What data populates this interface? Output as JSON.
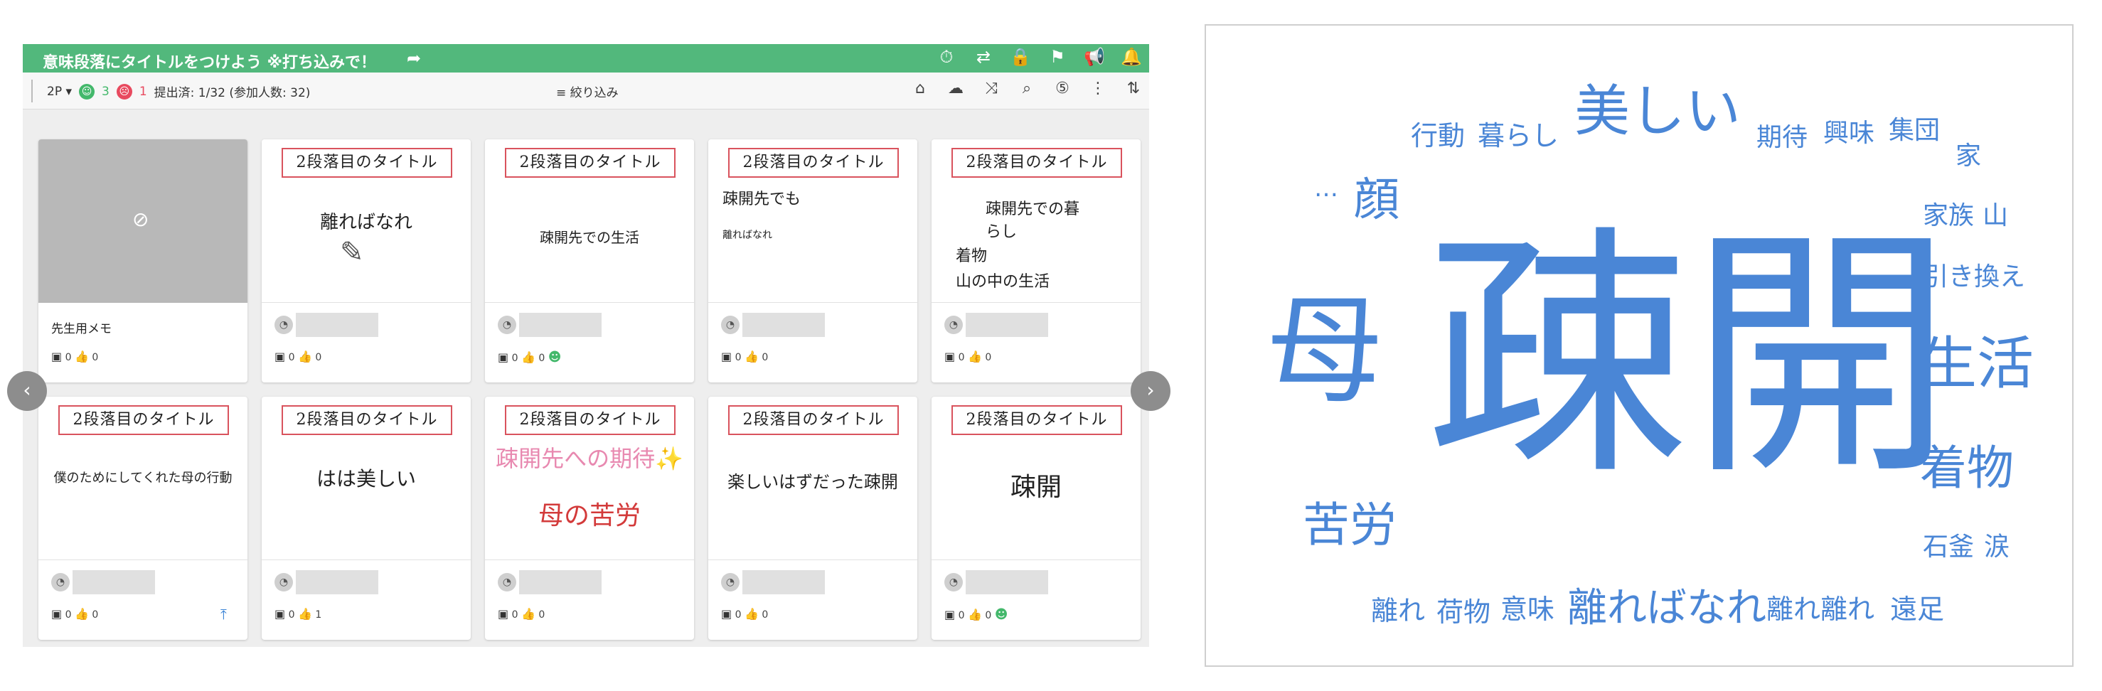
{
  "app": {
    "title": "意味段落にタイトルをつけよう ※打ち込みで！",
    "share_icon": "share-arrow-icon",
    "header_icons": [
      "timer-icon",
      "translate-icon",
      "lock-icon",
      "person-flag-icon",
      "megaphone-icon",
      "bell-icon"
    ],
    "toolbar": {
      "view_mode": "2P",
      "good_count": "3",
      "bad_count": "1",
      "submission": "提出済: 1/32 (参加人数: 32)",
      "filter_label": "絞り込み",
      "tool_icons": [
        "tag-icon",
        "cloud-abc-icon",
        "shuffle-icon",
        "qr-search-icon",
        "number-5-icon",
        "more-vertical-icon",
        "sort-icon"
      ]
    },
    "header_title": "2段落目のタイトル",
    "teacher_memo": "先生用メモ",
    "cards": [
      {
        "body": "",
        "comments": "0",
        "likes": "0",
        "teacher": true
      },
      {
        "body": "離ればなれ",
        "comments": "0",
        "likes": "0"
      },
      {
        "body": "疎開先での生活",
        "comments": "0",
        "likes": "0",
        "smile": true
      },
      {
        "body_lines": [
          "疎開先でも",
          "離ればなれ"
        ],
        "comments": "0",
        "likes": "0"
      },
      {
        "body_lines": [
          "疎開先での暮",
          "らし",
          "着物",
          "山の中の生活"
        ],
        "comments": "0",
        "likes": "0"
      },
      {
        "body": "僕のためにしてくれた母の行動",
        "comments": "0",
        "likes": "0",
        "pinned": true
      },
      {
        "body": "はは美しい",
        "comments": "0",
        "likes": "1"
      },
      {
        "body_lines": [
          "疎開先への期待✨",
          "母の苦労"
        ],
        "comments": "0",
        "likes": "0"
      },
      {
        "body": "楽しいはずだった疎開",
        "comments": "0",
        "likes": "0"
      },
      {
        "body": "疎開",
        "comments": "0",
        "likes": "0",
        "smile": true
      }
    ]
  },
  "wordcloud": {
    "color": "#4a86d6",
    "words": [
      {
        "text": "疎開",
        "weight": 1.0
      },
      {
        "text": "母",
        "weight": 0.45
      },
      {
        "text": "美しい",
        "weight": 0.33
      },
      {
        "text": "生活",
        "weight": 0.32
      },
      {
        "text": "着物",
        "weight": 0.27
      },
      {
        "text": "苦労",
        "weight": 0.27
      },
      {
        "text": "顔",
        "weight": 0.25
      },
      {
        "text": "離ればなれ",
        "weight": 0.24
      },
      {
        "text": "行動",
        "weight": 0.15
      },
      {
        "text": "暮らし",
        "weight": 0.15
      },
      {
        "text": "期待",
        "weight": 0.14
      },
      {
        "text": "興味",
        "weight": 0.14
      },
      {
        "text": "集団",
        "weight": 0.14
      },
      {
        "text": "家",
        "weight": 0.14
      },
      {
        "text": "家族",
        "weight": 0.14
      },
      {
        "text": "山",
        "weight": 0.14
      },
      {
        "text": "引き換え",
        "weight": 0.14
      },
      {
        "text": "石釜",
        "weight": 0.14
      },
      {
        "text": "涙",
        "weight": 0.14
      },
      {
        "text": "離れ",
        "weight": 0.15
      },
      {
        "text": "荷物",
        "weight": 0.15
      },
      {
        "text": "意味",
        "weight": 0.15
      },
      {
        "text": "離れ離れ",
        "weight": 0.15
      },
      {
        "text": "遠足",
        "weight": 0.15
      },
      {
        "text": "…",
        "weight": 0.1
      }
    ]
  }
}
